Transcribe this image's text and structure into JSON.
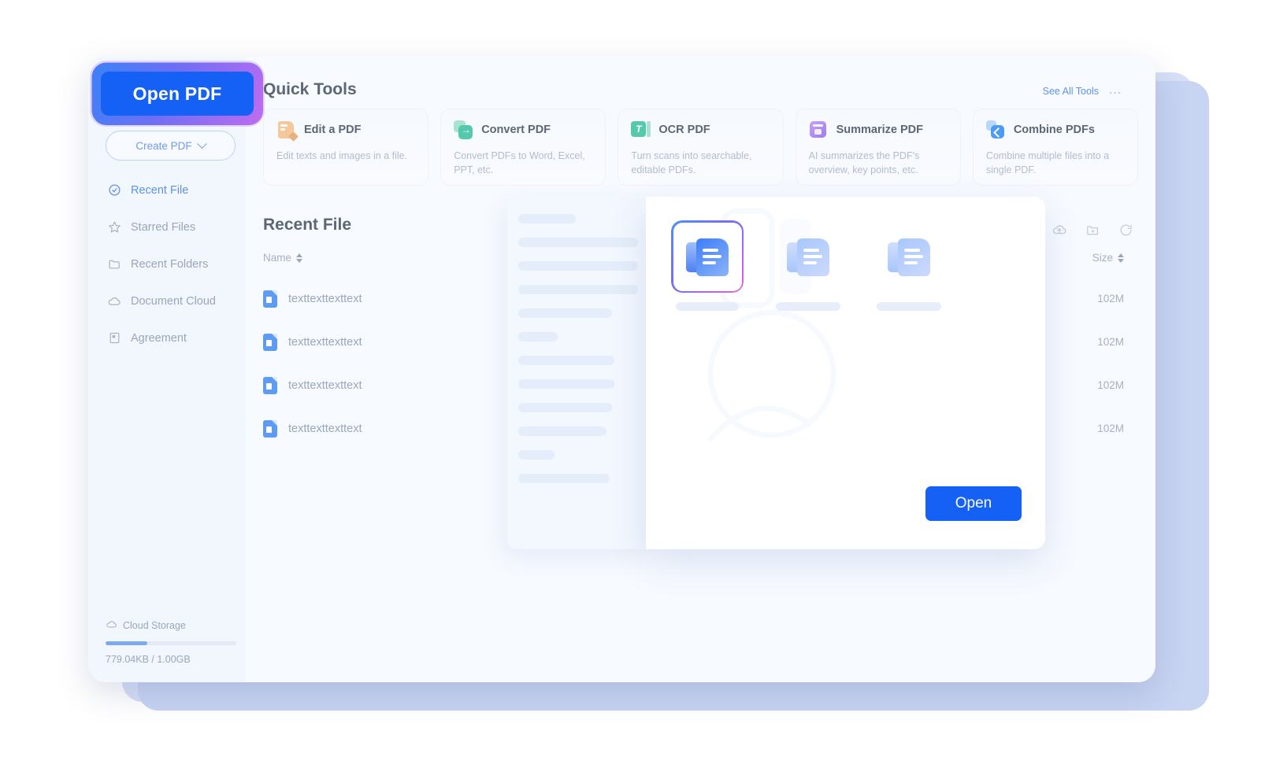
{
  "sidebar": {
    "open_pdf_label": "Open PDF",
    "create_pdf_label": "Create PDF",
    "items": [
      {
        "label": "Recent File",
        "icon": "clock-check-icon",
        "active": true
      },
      {
        "label": "Starred Files",
        "icon": "star-icon",
        "active": false
      },
      {
        "label": "Recent Folders",
        "icon": "folder-icon",
        "active": false
      },
      {
        "label": "Document Cloud",
        "icon": "cloud-icon",
        "active": false
      },
      {
        "label": "Agreement",
        "icon": "document-icon",
        "active": false
      }
    ],
    "storage": {
      "label": "Cloud Storage",
      "usage_text": "779.04KB / 1.00GB",
      "percent": 32
    }
  },
  "quick_tools": {
    "heading": "Quick Tools",
    "see_all_label": "See All Tools",
    "more_label": "⋯",
    "cards": [
      {
        "title": "Edit a PDF",
        "desc": "Edit texts and images in a file.",
        "icon": "edit-pdf-icon"
      },
      {
        "title": "Convert PDF",
        "desc": "Convert PDFs to Word, Excel, PPT, etc.",
        "icon": "convert-pdf-icon"
      },
      {
        "title": "OCR PDF",
        "desc": "Turn scans into searchable, editable PDFs.",
        "icon": "ocr-pdf-icon"
      },
      {
        "title": "Summarize PDF",
        "desc": "AI summarizes the PDF's overview, key points, etc.",
        "icon": "summarize-pdf-icon"
      },
      {
        "title": "Combine PDFs",
        "desc": "Combine multiple files into a single PDF.",
        "icon": "combine-pdfs-icon"
      }
    ]
  },
  "recent_file": {
    "heading": "Recent File",
    "search_placeholder": "",
    "toolbar": [
      {
        "icon": "list-view-icon"
      },
      {
        "icon": "grid-view-icon"
      },
      {
        "icon": "cloud-upload-icon"
      },
      {
        "icon": "new-folder-icon"
      },
      {
        "icon": "refresh-icon"
      }
    ],
    "columns": {
      "name": "Name",
      "size": "Size"
    },
    "rows": [
      {
        "name": "texttexttexttext",
        "size": "102M"
      },
      {
        "name": "texttexttexttext",
        "size": "102M"
      },
      {
        "name": "texttexttexttext",
        "size": "102M"
      },
      {
        "name": "texttexttexttext",
        "size": "102M"
      }
    ]
  },
  "dialog": {
    "open_label": "Open",
    "thumbnails": [
      {
        "selected": true
      },
      {
        "selected": false
      },
      {
        "selected": false
      }
    ]
  },
  "colors": {
    "primary_blue": "#1560f5",
    "accent_link": "#5e93ec",
    "sidebar_bg": "#f2f6fd",
    "main_bg": "#f7faff",
    "highlight_ring": "#8a6cf0"
  }
}
